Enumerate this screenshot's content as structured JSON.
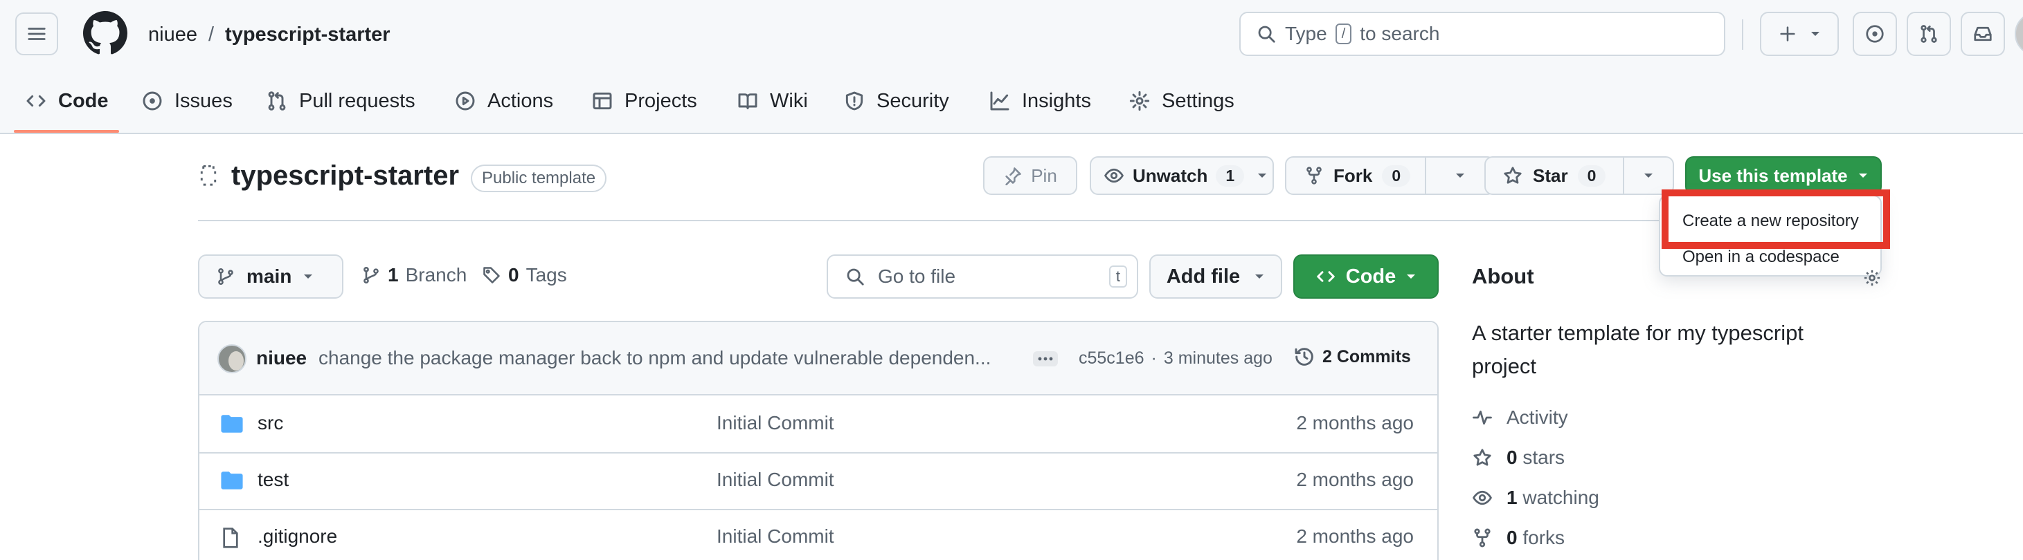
{
  "header": {
    "owner": "niuee",
    "separator": "/",
    "repo": "typescript-starter",
    "search_prefix": "Type",
    "search_key": "/",
    "search_suffix": "to search",
    "plus_label": "+"
  },
  "tabs": [
    {
      "label": "Code",
      "icon": "code-icon",
      "active": true
    },
    {
      "label": "Issues",
      "icon": "issue-icon"
    },
    {
      "label": "Pull requests",
      "icon": "pull-request-icon"
    },
    {
      "label": "Actions",
      "icon": "play-icon"
    },
    {
      "label": "Projects",
      "icon": "table-icon"
    },
    {
      "label": "Wiki",
      "icon": "book-icon"
    },
    {
      "label": "Security",
      "icon": "shield-icon"
    },
    {
      "label": "Insights",
      "icon": "graph-icon"
    },
    {
      "label": "Settings",
      "icon": "gear-icon"
    }
  ],
  "repo_header": {
    "name": "typescript-starter",
    "visibility": "Public template",
    "pin": "Pin",
    "unwatch": "Unwatch",
    "watch_count": "1",
    "fork": "Fork",
    "fork_count": "0",
    "star": "Star",
    "star_count": "0",
    "use_template": "Use this template"
  },
  "template_menu": {
    "items": [
      "Create a new repository",
      "Open in a codespace"
    ],
    "highlight_color": "#e5382b"
  },
  "toolbar": {
    "branch": "main",
    "branch_count": "1",
    "branch_label": "Branch",
    "tag_count": "0",
    "tag_label": "Tags",
    "goto_placeholder": "Go to file",
    "goto_key": "t",
    "add_file": "Add file",
    "code": "Code"
  },
  "latest_commit": {
    "author": "niuee",
    "message": "change the package manager back to npm and update vulnerable dependen...",
    "sha": "c55c1e6",
    "dot": "·",
    "time": "3 minutes ago",
    "commits_label": "2 Commits"
  },
  "files": [
    {
      "name": "src",
      "type": "folder",
      "message": "Initial Commit",
      "age": "2 months ago"
    },
    {
      "name": "test",
      "type": "folder",
      "message": "Initial Commit",
      "age": "2 months ago"
    },
    {
      "name": ".gitignore",
      "type": "file",
      "message": "Initial Commit",
      "age": "2 months ago"
    }
  ],
  "about": {
    "title": "About",
    "description": "A starter template for my typescript project",
    "activity": "Activity",
    "stars_count": "0",
    "stars_label": "stars",
    "watching_count": "1",
    "watching_label": "watching",
    "forks_count": "0",
    "forks_label": "forks"
  },
  "colors": {
    "accent_green": "#2c974b",
    "tab_underline": "#fd8c73",
    "folder_blue": "#54aeff"
  }
}
